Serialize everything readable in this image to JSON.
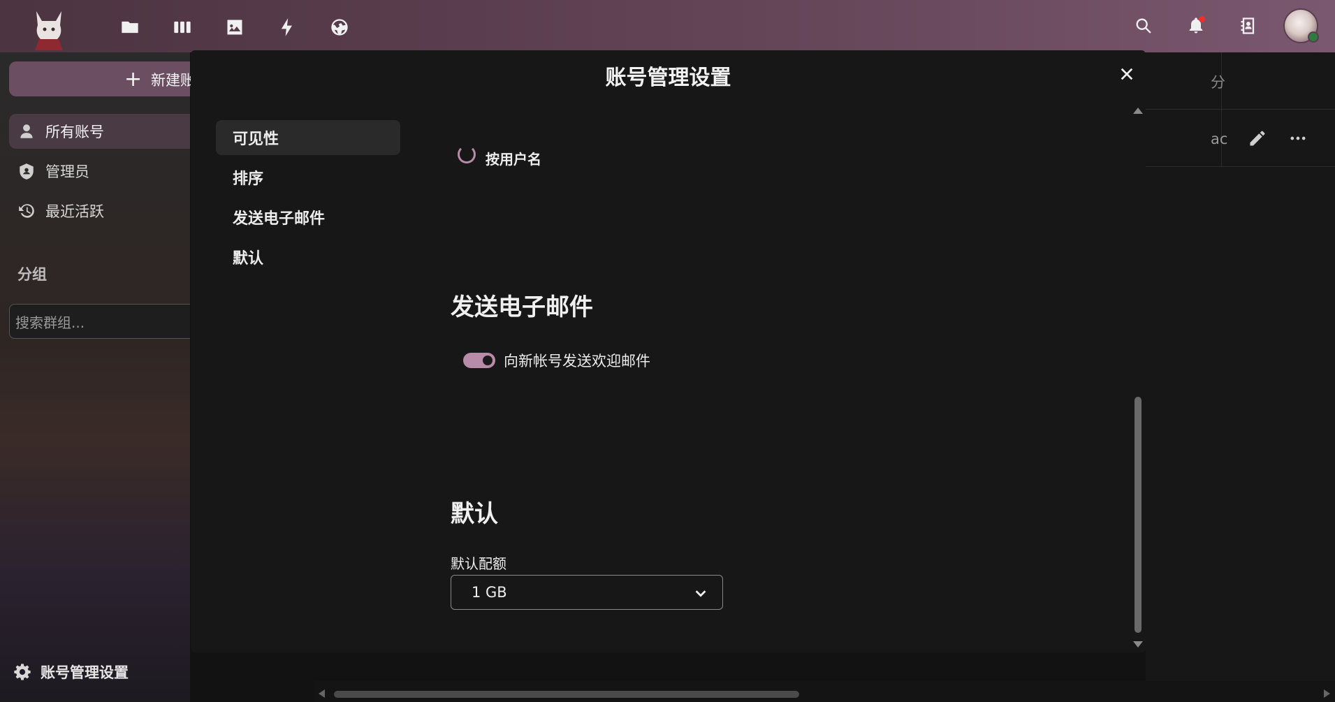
{
  "topbar": {
    "apps": [
      {
        "name": "files-icon"
      },
      {
        "name": "dashboard-icon"
      },
      {
        "name": "photos-icon"
      },
      {
        "name": "activity-icon"
      },
      {
        "name": "globe-icon"
      }
    ],
    "right": [
      "search-icon",
      "notifications-icon",
      "contacts-icon",
      "avatar"
    ]
  },
  "sidebar": {
    "new_account_label": "新建账",
    "items": [
      {
        "label": "所有账号",
        "icon": "user-icon",
        "active": true
      },
      {
        "label": "管理员",
        "icon": "shield-icon",
        "active": false
      },
      {
        "label": "最近活跃",
        "icon": "history-icon",
        "active": false
      }
    ],
    "groups_title": "分组",
    "group_search_placeholder": "搜索群组...",
    "settings_label": "账号管理设置"
  },
  "background": {
    "header_text": "分",
    "row_text": "ac"
  },
  "modal": {
    "title": "账号管理设置",
    "nav": [
      {
        "label": "可见性",
        "active": true
      },
      {
        "label": "排序",
        "active": false
      },
      {
        "label": "发送电子邮件",
        "active": false
      },
      {
        "label": "默认",
        "active": false
      }
    ],
    "sort_option_label": "按用户名",
    "email_section_title": "发送电子邮件",
    "welcome_email_label": "向新帐号发送欢迎邮件",
    "welcome_email_enabled": true,
    "defaults_section_title": "默认",
    "quota_label": "默认配额",
    "quota_value": "1 GB"
  },
  "colors": {
    "accent": "#b88ba8",
    "topbar": "#5a3d4e"
  }
}
